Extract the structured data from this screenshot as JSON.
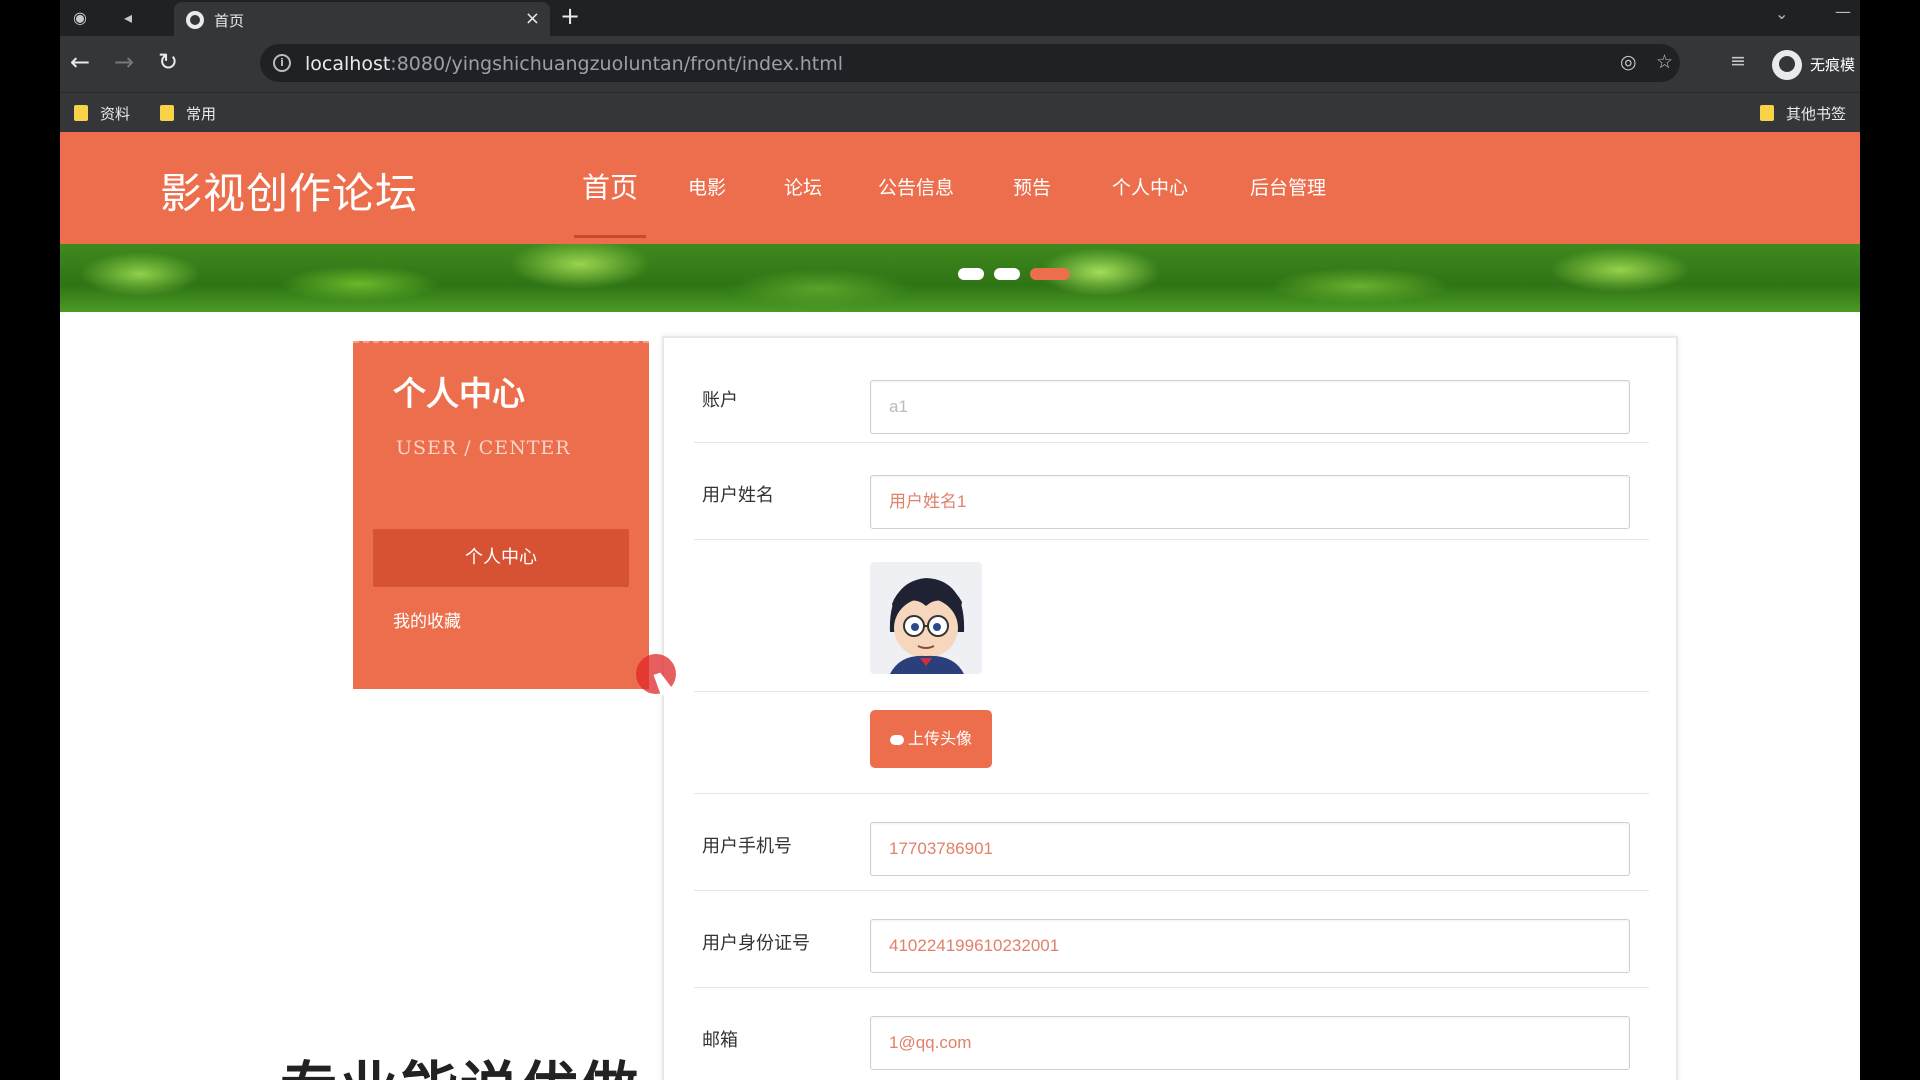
{
  "browser": {
    "tab_title": "首页",
    "url_host": "localhost",
    "url_rest": ":8080/yingshichuangzuoluntan/front/index.html",
    "profile_label": "无痕模",
    "bookmarks": [
      "资料",
      "常用"
    ],
    "other_bookmarks": "其他书签"
  },
  "site": {
    "logo": "影视创作论坛",
    "menu": [
      "首页",
      "电影",
      "论坛",
      "公告信息",
      "预告",
      "个人中心",
      "后台管理"
    ],
    "active_menu": "首页",
    "brand_color": "#ec6e4d"
  },
  "sidebar": {
    "title": "个人中心",
    "subtitle": "USER / CENTER",
    "active_item": "个人中心",
    "link": "我的收藏"
  },
  "form": {
    "account_label": "账户",
    "account_value": "a1",
    "name_label": "用户姓名",
    "name_value": "用户姓名1",
    "upload_label": "上传头像",
    "phone_label": "用户手机号",
    "phone_value": "17703786901",
    "idcard_label": "用户身份证号",
    "idcard_value": "410224199610232001",
    "email_label": "邮箱",
    "email_value": "1@qq.com"
  },
  "page_bottom_text": "专业能说优做"
}
